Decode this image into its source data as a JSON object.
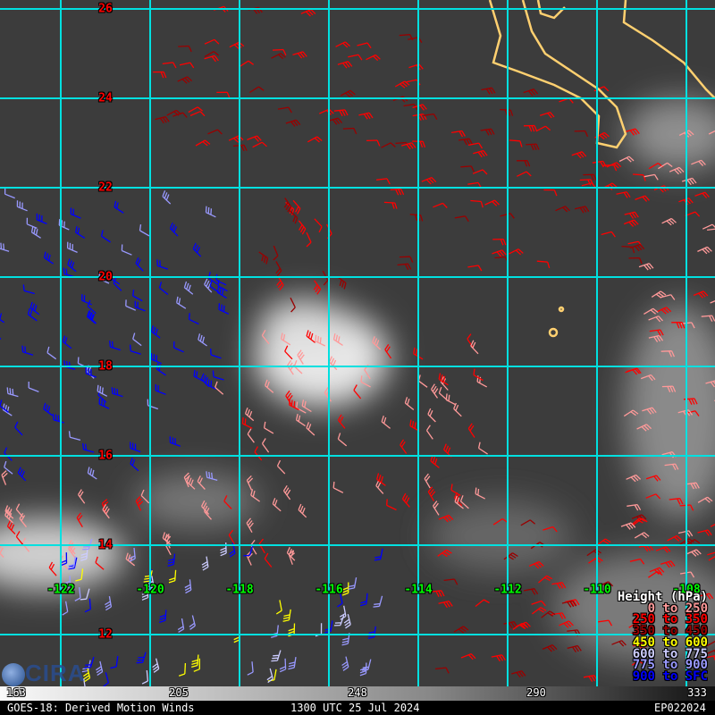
{
  "title": "GOES-18: Derived Motion Winds",
  "time": "1300 UTC 25 Jul 2024",
  "storm_id": "EP022024",
  "logo_text": "CIRA",
  "latitudes": [
    "26",
    "24",
    "22",
    "20",
    "18",
    "16",
    "14",
    "12"
  ],
  "longitudes": [
    "-122",
    "-120",
    "-118",
    "-116",
    "-114",
    "-112",
    "-110",
    "-108"
  ],
  "legend": {
    "title": "Height (hPa)",
    "items": [
      {
        "label": "0 to 250",
        "color": "#ff9999"
      },
      {
        "label": "250 to 350",
        "color": "#ff0000"
      },
      {
        "label": "350 to 450",
        "color": "#990000"
      },
      {
        "label": "450 to 600",
        "color": "#ffff00"
      },
      {
        "label": "600 to 775",
        "color": "#ccccff"
      },
      {
        "label": "775 to 900",
        "color": "#9999ff"
      },
      {
        "label": "900 to SFC",
        "color": "#0000ff"
      }
    ]
  },
  "colorbar": [
    "163",
    "205",
    "248",
    "290",
    "333"
  ],
  "colors": {
    "grid": "#00e5e5",
    "coast": "#ffd070",
    "background": "#3c3c3c"
  }
}
